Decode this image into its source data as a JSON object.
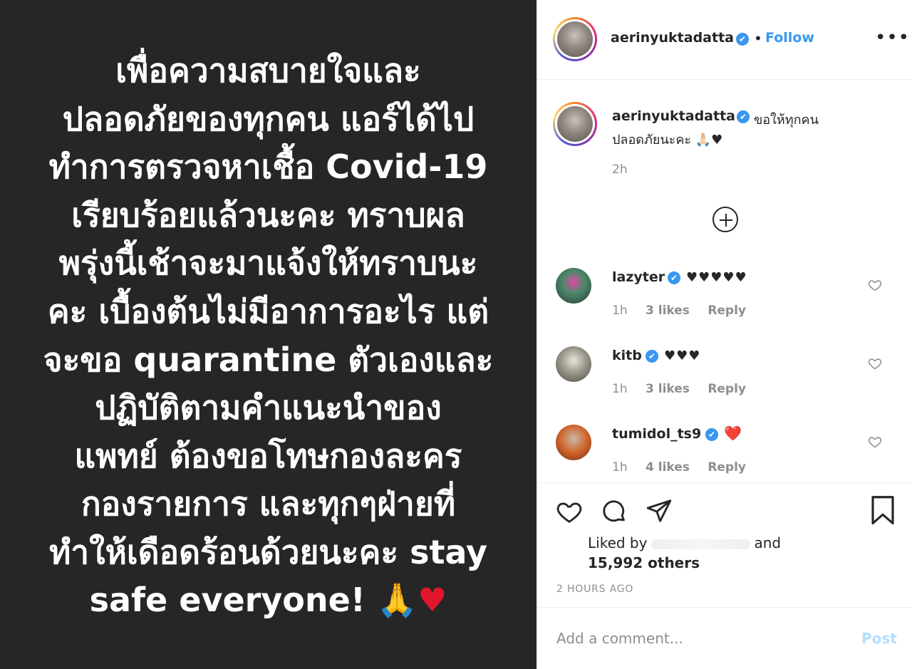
{
  "post_image": {
    "line_1": "เพื่อความสบายใจและ",
    "line_2": "ปลอดภัยของทุกคน แอร์ได้ไป",
    "line_3": "ทำการตรวจหาเชื้อ Covid-19",
    "line_4": "เรียบร้อยแล้วนะคะ ทราบผล",
    "line_5": "พรุ่งนี้เช้าจะมาแจ้งให้ทราบนะ",
    "line_6": "คะ เบื้องต้นไม่มีอาการอะไร แต่",
    "line_7": "จะขอ quarantine ตัวเองและ",
    "line_8": "ปฏิบัติตามคำแนะนำของ",
    "line_9": "แพทย์ ต้องขอโทษกองละคร",
    "line_10": "กองรายการ และทุกๆฝ่ายที่",
    "line_11": "ทำให้เดือดร้อนด้วยนะคะ stay",
    "line_12": "safe everyone!",
    "emoji_1": "🙏",
    "emoji_2": "♥"
  },
  "header": {
    "username": "aerinyuktadatta",
    "verified_icon": "✔",
    "separator": "•",
    "follow_label": "Follow",
    "more_label": "•••"
  },
  "caption": {
    "username": "aerinyuktadatta",
    "text_line_1": "ขอให้ทุกคน",
    "text_line_2": "ปลอดภัยนะคะ 🙏🏻♥",
    "time": "2h"
  },
  "comments": [
    {
      "username": "lazyter",
      "text": "♥♥♥♥♥",
      "time": "1h",
      "likes": "3 likes",
      "reply": "Reply",
      "avatar_color": "#4a8a6a"
    },
    {
      "username": "kitb",
      "text": "♥♥♥",
      "time": "1h",
      "likes": "3 likes",
      "reply": "Reply",
      "avatar_color": "#8d8a80"
    },
    {
      "username": "tumidol_ts9",
      "text": "❤️",
      "time": "1h",
      "likes": "4 likes",
      "reply": "Reply",
      "avatar_color": "#d0632a"
    }
  ],
  "actions": {
    "liked_by_prefix": "Liked by",
    "liked_by_and": "and",
    "liked_by_others": "15,992 others",
    "timestamp": "2 HOURS AGO"
  },
  "comment_box": {
    "placeholder": "Add a comment...",
    "post_label": "Post"
  },
  "colors": {
    "link_blue": "#3897f0",
    "post_disabled": "#b2dffc",
    "image_bg": "#262626"
  }
}
